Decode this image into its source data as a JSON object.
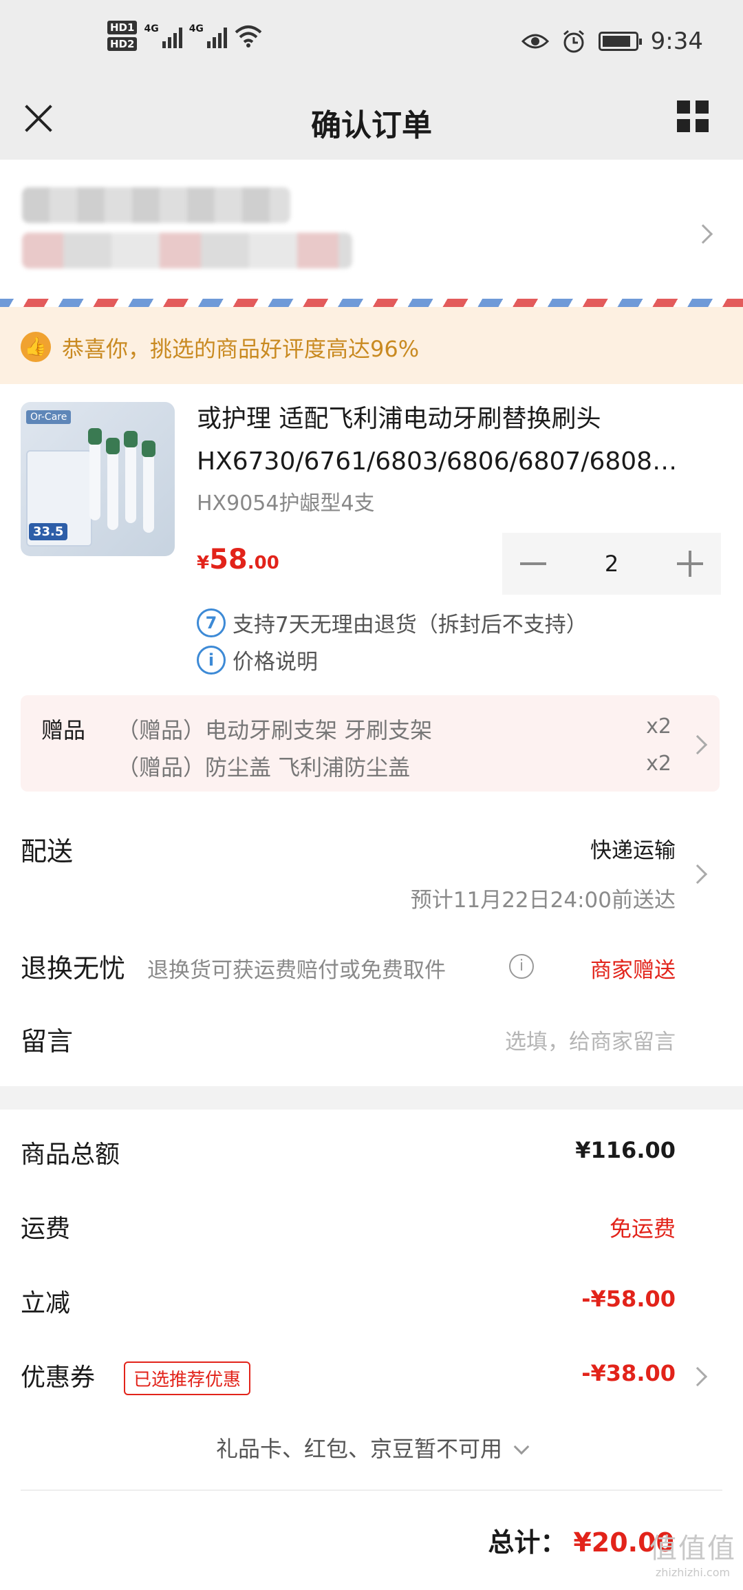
{
  "status_bar": {
    "hd1": "HD1",
    "hd2": "HD2",
    "net1": "4G",
    "net2": "4G",
    "time": "9:34"
  },
  "header": {
    "title": "确认订单"
  },
  "praise_banner": {
    "icon": "thumbs-up-icon",
    "text": "恭喜你，挑选的商品好评度高达96%"
  },
  "product": {
    "thumb_brand": "Or-Care",
    "thumb_price": "33.5",
    "title": "或护理 适配飞利浦电动牙刷替换刷头HX6730/6761/6803/6806/6807/6808…",
    "spec": "HX9054护龈型4支",
    "price_yen": "¥",
    "price_int": "58",
    "price_dec": ".00",
    "quantity": "2",
    "return_badge": "7",
    "return_policy": "支持7天无理由退货（拆封后不支持）",
    "price_info_icon": "i",
    "price_note": "价格说明"
  },
  "gifts": {
    "label": "赠品",
    "items": [
      {
        "name": "（赠品）电动牙刷支架 牙刷支架",
        "qty": "x2"
      },
      {
        "name": "（赠品）防尘盖 飞利浦防尘盖",
        "qty": "x2"
      }
    ]
  },
  "delivery": {
    "label": "配送",
    "method": "快递运输",
    "eta": "预计11月22日24:00前送达"
  },
  "returns": {
    "label": "退换无忧",
    "desc": "退换货可获运费赔付或免费取件",
    "info_icon": "i",
    "value": "商家赠送"
  },
  "message": {
    "label": "留言",
    "placeholder": "选填，给商家留言"
  },
  "summary": {
    "goods_total_label": "商品总额",
    "goods_total": "¥116.00",
    "shipping_label": "运费",
    "shipping": "免运费",
    "discount_label": "立减",
    "discount": "-¥58.00",
    "coupon_label": "优惠券",
    "coupon_tag": "已选推荐优惠",
    "coupon": "-¥38.00",
    "unavailable": "礼品卡、红包、京豆暂不可用",
    "total_label": "总计：",
    "total": "¥20.00"
  },
  "watermark": {
    "logo": "值值值",
    "site": "zhizhizhi.com"
  },
  "colors": {
    "accent_red": "#e2231a",
    "banner_bg": "#fdf0e1",
    "banner_text": "#c98a21",
    "link_blue": "#3d8ad6"
  }
}
